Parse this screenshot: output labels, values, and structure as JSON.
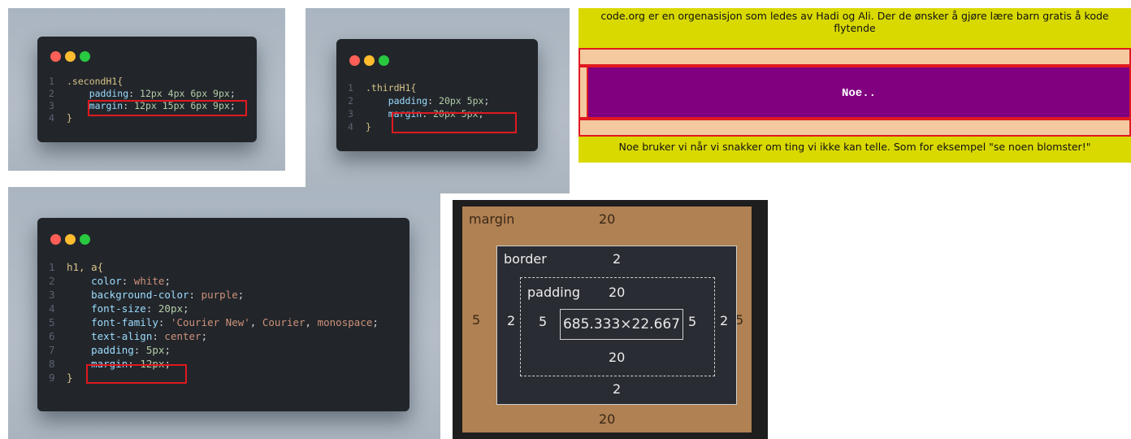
{
  "panel1": {
    "lines": [
      {
        "n": "1",
        "parts": [
          {
            "t": ".secondH1{",
            "c": "sel"
          }
        ]
      },
      {
        "n": "2",
        "parts": [
          {
            "t": "    padding",
            "c": "prop"
          },
          {
            "t": ": ",
            "c": "pun"
          },
          {
            "t": "12px 4px 6px 9px",
            "c": "val"
          },
          {
            "t": ";",
            "c": "pun"
          }
        ]
      },
      {
        "n": "3",
        "parts": [
          {
            "t": "    margin",
            "c": "prop"
          },
          {
            "t": ": ",
            "c": "pun"
          },
          {
            "t": "12px 15px 6px 9px",
            "c": "val"
          },
          {
            "t": ";",
            "c": "pun"
          }
        ]
      },
      {
        "n": "4",
        "parts": [
          {
            "t": "}",
            "c": "sel"
          }
        ]
      }
    ]
  },
  "panel2": {
    "lines": [
      {
        "n": "1",
        "parts": [
          {
            "t": ".thirdH1{",
            "c": "sel"
          }
        ]
      },
      {
        "n": "2",
        "parts": [
          {
            "t": "    padding",
            "c": "prop"
          },
          {
            "t": ": ",
            "c": "pun"
          },
          {
            "t": "20px 5px",
            "c": "val"
          },
          {
            "t": ";",
            "c": "pun"
          }
        ]
      },
      {
        "n": "3",
        "parts": [
          {
            "t": "    margin",
            "c": "prop"
          },
          {
            "t": ": ",
            "c": "pun"
          },
          {
            "t": "20px 5px",
            "c": "val"
          },
          {
            "t": ";",
            "c": "pun"
          }
        ]
      },
      {
        "n": "4",
        "parts": [
          {
            "t": "}",
            "c": "sel"
          }
        ]
      }
    ]
  },
  "panel3": {
    "lines": [
      {
        "n": "1",
        "parts": [
          {
            "t": "h1, a{",
            "c": "sel"
          }
        ]
      },
      {
        "n": "2",
        "parts": [
          {
            "t": "    color",
            "c": "prop"
          },
          {
            "t": ": ",
            "c": "pun"
          },
          {
            "t": "white",
            "c": "str"
          },
          {
            "t": ";",
            "c": "pun"
          }
        ]
      },
      {
        "n": "3",
        "parts": [
          {
            "t": "    background-color",
            "c": "prop"
          },
          {
            "t": ": ",
            "c": "pun"
          },
          {
            "t": "purple",
            "c": "str"
          },
          {
            "t": ";",
            "c": "pun"
          }
        ]
      },
      {
        "n": "4",
        "parts": [
          {
            "t": "    font-size",
            "c": "prop"
          },
          {
            "t": ": ",
            "c": "pun"
          },
          {
            "t": "20px",
            "c": "val"
          },
          {
            "t": ";",
            "c": "pun"
          }
        ]
      },
      {
        "n": "5",
        "parts": [
          {
            "t": "    font-family",
            "c": "prop"
          },
          {
            "t": ": ",
            "c": "pun"
          },
          {
            "t": "'Courier New'",
            "c": "str"
          },
          {
            "t": ", ",
            "c": "pun"
          },
          {
            "t": "Courier",
            "c": "str"
          },
          {
            "t": ", ",
            "c": "pun"
          },
          {
            "t": "monospace",
            "c": "str"
          },
          {
            "t": ";",
            "c": "pun"
          }
        ]
      },
      {
        "n": "6",
        "parts": [
          {
            "t": "    text-align",
            "c": "prop"
          },
          {
            "t": ": ",
            "c": "pun"
          },
          {
            "t": "center",
            "c": "str"
          },
          {
            "t": ";",
            "c": "pun"
          }
        ]
      },
      {
        "n": "7",
        "parts": [
          {
            "t": "    padding",
            "c": "prop"
          },
          {
            "t": ": ",
            "c": "pun"
          },
          {
            "t": "5px",
            "c": "val"
          },
          {
            "t": ";",
            "c": "pun"
          }
        ]
      },
      {
        "n": "8",
        "parts": [
          {
            "t": "    margin",
            "c": "prop"
          },
          {
            "t": ": ",
            "c": "pun"
          },
          {
            "t": "12px",
            "c": "val"
          },
          {
            "t": ";",
            "c": "pun"
          }
        ]
      },
      {
        "n": "9",
        "parts": [
          {
            "t": "}",
            "c": "sel"
          }
        ]
      }
    ]
  },
  "rendered": {
    "top_text": "code.org er en orgenasisjon som ledes av Hadi og Ali. Der de ønsker å gjøre lære barn gratis å kode flytende",
    "heading": "Noe..",
    "bottom_text": "Noe bruker vi når vi snakker om ting vi ikke kan telle. Som for eksempel \"se noen blomster!\""
  },
  "boxmodel": {
    "margin_label": "margin",
    "margin_top": "20",
    "margin_bottom": "20",
    "margin_left": "5",
    "margin_right": "5",
    "border_label": "border",
    "border_top": "2",
    "border_bottom": "2",
    "border_left": "2",
    "border_right": "2",
    "padding_label": "padding",
    "padding_top": "20",
    "padding_bottom": "20",
    "padding_left": "5",
    "padding_right": "5",
    "content_size": "685.333×22.667"
  },
  "colors": {
    "highlight": "#e0191f",
    "yellow": "#d9d900",
    "peach": "#f4c9a0",
    "purple": "#800080",
    "margin_brown": "#b08152"
  }
}
